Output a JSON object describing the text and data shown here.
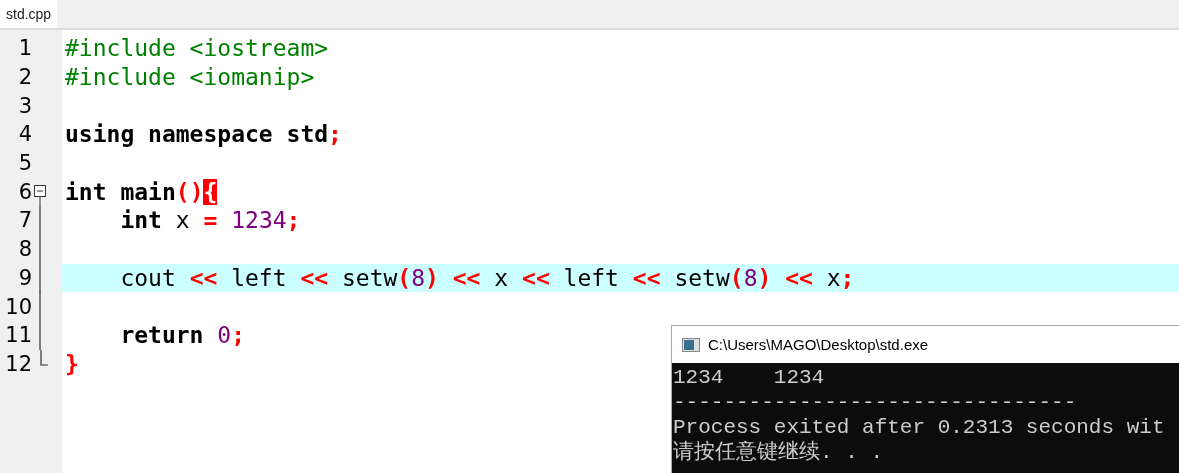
{
  "tabs": [
    {
      "label": "std.cpp",
      "selected": true
    }
  ],
  "editor": {
    "lines": [
      {
        "number": "1",
        "current": false,
        "kind": "plain",
        "tokens": [
          {
            "kind": "pp",
            "text": "#include <iostream>"
          }
        ]
      },
      {
        "number": "2",
        "current": false,
        "kind": "plain",
        "tokens": [
          {
            "kind": "pp",
            "text": "#include <iomanip>"
          }
        ]
      },
      {
        "number": "3",
        "current": false,
        "kind": "plain"
      },
      {
        "number": "4",
        "current": false,
        "kind": "plain",
        "tokens": [
          {
            "kind": "kw",
            "text": "using namespace std"
          },
          {
            "kind": "op",
            "text": ";"
          }
        ]
      },
      {
        "number": "5",
        "current": false,
        "kind": "plain"
      },
      {
        "number": "6",
        "current": false,
        "kind": "fold-start",
        "tokens": [
          {
            "kind": "kw",
            "text": "int main"
          },
          {
            "kind": "op",
            "text": "()"
          },
          {
            "kind": "brace-match",
            "text": "{"
          }
        ]
      },
      {
        "number": "7",
        "current": false,
        "kind": "fold-line",
        "tokens": [
          {
            "kind": "kw",
            "text": "    int "
          },
          {
            "kind": "plain",
            "text": "x "
          },
          {
            "kind": "op",
            "text": "= "
          },
          {
            "kind": "num",
            "text": "1234"
          },
          {
            "kind": "op",
            "text": ";"
          }
        ]
      },
      {
        "number": "8",
        "current": false,
        "kind": "fold-line"
      },
      {
        "number": "9",
        "current": true,
        "kind": "fold-line",
        "tokens": [
          {
            "kind": "plain",
            "text": "    cout "
          },
          {
            "kind": "op",
            "text": "<< "
          },
          {
            "kind": "plain",
            "text": "left "
          },
          {
            "kind": "op",
            "text": "<< "
          },
          {
            "kind": "plain",
            "text": "setw"
          },
          {
            "kind": "op",
            "text": "("
          },
          {
            "kind": "num",
            "text": "8"
          },
          {
            "kind": "op",
            "text": ") << "
          },
          {
            "kind": "plain",
            "text": "x "
          },
          {
            "kind": "op",
            "text": "<< "
          },
          {
            "kind": "plain",
            "text": "left "
          },
          {
            "kind": "op",
            "text": "<< "
          },
          {
            "kind": "plain",
            "text": "setw"
          },
          {
            "kind": "op",
            "text": "("
          },
          {
            "kind": "num",
            "text": "8"
          },
          {
            "kind": "op",
            "text": ") << "
          },
          {
            "kind": "plain",
            "text": "x"
          },
          {
            "kind": "op",
            "text": ";"
          }
        ]
      },
      {
        "number": "10",
        "current": false,
        "kind": "fold-line"
      },
      {
        "number": "11",
        "current": false,
        "kind": "fold-line",
        "tokens": [
          {
            "kind": "kw",
            "text": "    return "
          },
          {
            "kind": "num",
            "text": "0"
          },
          {
            "kind": "op",
            "text": ";"
          }
        ]
      },
      {
        "number": "12",
        "current": false,
        "kind": "fold-end",
        "tokens": [
          {
            "kind": "op",
            "text": "}"
          }
        ]
      }
    ]
  },
  "console": {
    "title": "C:\\Users\\MAGO\\Desktop\\std.exe",
    "lines": [
      "1234    1234",
      "--------------------------------",
      "Process exited after 0.2313 seconds wit",
      "请按任意键继续. . ."
    ]
  }
}
